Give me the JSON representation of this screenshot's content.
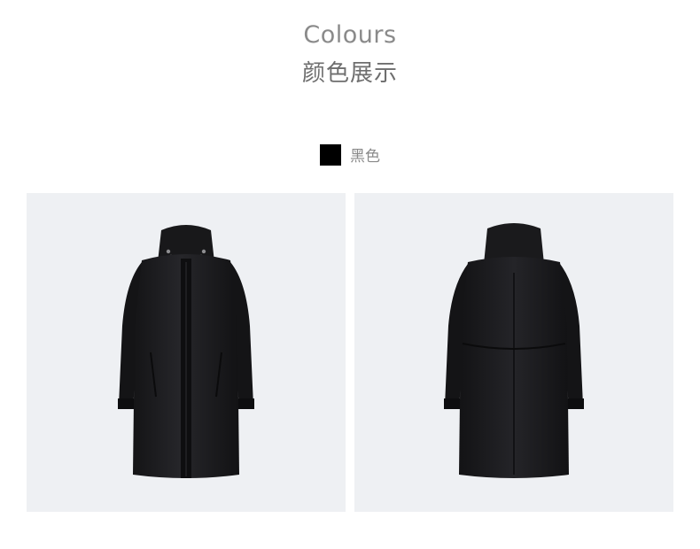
{
  "heading": {
    "title_en": "Colours",
    "title_cn": "颜色展示"
  },
  "colour_option": {
    "label": "黑色",
    "swatch_color": "#000000"
  },
  "product_images": [
    {
      "view": "front",
      "icon": "black-long-parka-front"
    },
    {
      "view": "back",
      "icon": "black-long-parka-back"
    }
  ],
  "colors": {
    "background": "#ffffff",
    "panel_background": "#eef0f3",
    "heading_en": "#8a8a8a",
    "heading_cn": "#6e6e6e",
    "jacket": "#1c1c1e"
  }
}
